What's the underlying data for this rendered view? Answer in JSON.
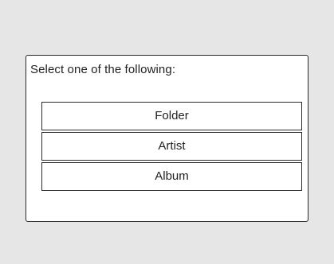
{
  "dialog": {
    "prompt": "Select one of the following:",
    "options": [
      {
        "label": "Folder"
      },
      {
        "label": "Artist"
      },
      {
        "label": "Album"
      }
    ]
  }
}
